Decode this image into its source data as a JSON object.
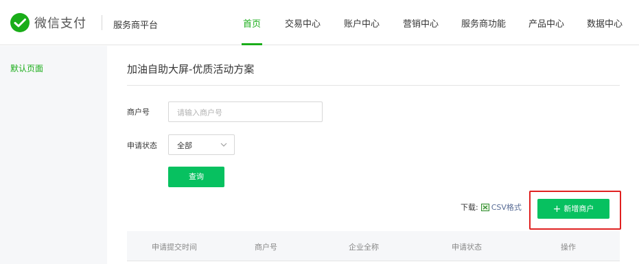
{
  "brand": {
    "logo_text": "微信支付",
    "platform_name": "服务商平台",
    "accent_color": "#1aad19"
  },
  "nav": {
    "items": [
      {
        "label": "首页",
        "active": true
      },
      {
        "label": "交易中心",
        "active": false
      },
      {
        "label": "账户中心",
        "active": false
      },
      {
        "label": "营销中心",
        "active": false
      },
      {
        "label": "服务商功能",
        "active": false
      },
      {
        "label": "产品中心",
        "active": false
      },
      {
        "label": "数据中心",
        "active": false
      }
    ]
  },
  "sidebar": {
    "items": [
      {
        "label": "默认页面",
        "active": true
      }
    ]
  },
  "main": {
    "title": "加油自助大屏-优质活动方案",
    "form": {
      "merchant_id_label": "商户号",
      "merchant_id_placeholder": "请输入商户号",
      "merchant_id_value": "",
      "status_label": "申请状态",
      "status_value": "全部",
      "query_button": "查询"
    },
    "download": {
      "label": "下载:",
      "csv_link": "CSV格式",
      "icon": "excel-file-icon"
    },
    "add_merchant_button": "新增商户",
    "table": {
      "columns": [
        "申请提交时间",
        "商户号",
        "企业全称",
        "申请状态",
        "操作"
      ],
      "rows": []
    }
  },
  "colors": {
    "primary_button": "#07c160",
    "highlight_border": "#e02020",
    "link": "#576b95"
  }
}
